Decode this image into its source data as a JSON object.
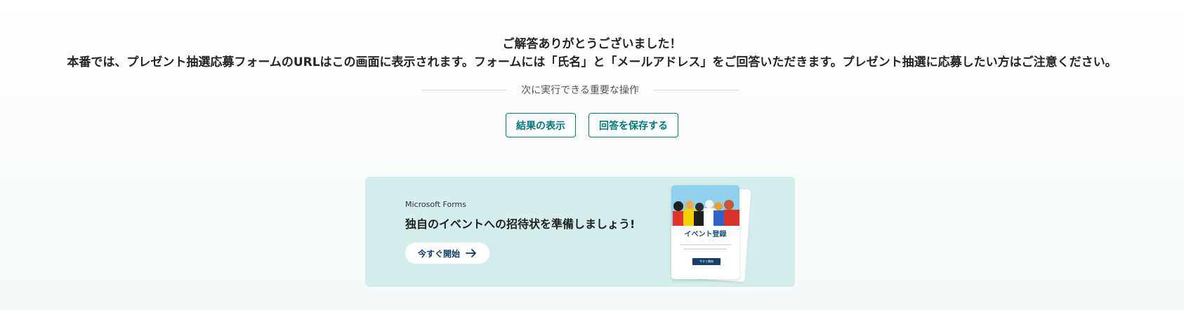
{
  "message": {
    "title": "ご解答ありがとうございました！",
    "body": "本番では、プレゼント抽選応募フォームのURLはこの画面に表示されます。フォームには「氏名」と「メールアドレス」をご回答いただきます。プレゼント抽選に応募したい方はご注意ください。"
  },
  "next_actions": {
    "heading": "次に実行できる重要な操作",
    "view_results_label": "結果の表示",
    "save_response_label": "回答を保存する"
  },
  "promo": {
    "brand": "Microsoft Forms",
    "headline": "独自のイベントへの招待状を準備しましょう!",
    "start_label": "今すぐ開始",
    "card_title": "イベント登録",
    "card_button": "今すぐ開始"
  },
  "colors": {
    "accent": "#03787c",
    "promo_background": "#d5edee",
    "card_button": "#163f6a"
  }
}
